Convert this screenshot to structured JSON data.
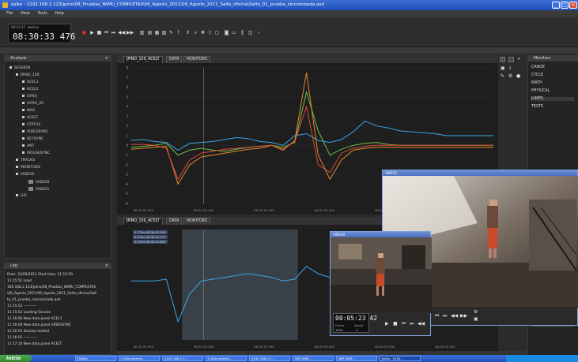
{
  "window": {
    "title": "qslko - \\\\192.168.2.123\\jpino\\08_Pruebas_WIMU_COMPLETAS\\06_Agosto_2011\\09_Agosto_2011_Salto_oficina\\Salto_01_prueba_sincronizada.qsd"
  },
  "menu": [
    "File",
    "View",
    "Tools",
    "Help"
  ],
  "clock": {
    "small_time": "00:03:37",
    "small_label": "session",
    "time": "08:30:33 476"
  },
  "analysis": {
    "title": "Analysis",
    "tree": [
      {
        "label": "SESSION",
        "indent": 0
      },
      {
        "label": "JPINO_150",
        "indent": 1
      },
      {
        "label": "ACEL1",
        "indent": 2
      },
      {
        "label": "ACEL2",
        "indent": 2
      },
      {
        "label": "GYRO",
        "indent": 2
      },
      {
        "label": "GYRO_45",
        "indent": 2
      },
      {
        "label": "MAG",
        "indent": 2
      },
      {
        "label": "ACELT",
        "indent": 2
      },
      {
        "label": "STATUS",
        "indent": 2
      },
      {
        "label": "VIDEOSYNC",
        "indent": 2
      },
      {
        "label": "KEYSYNC",
        "indent": 2
      },
      {
        "label": "ANT",
        "indent": 2
      },
      {
        "label": "MOUSESYNC",
        "indent": 2
      },
      {
        "label": "TRACKS",
        "indent": 1
      },
      {
        "label": "MONITORS",
        "indent": 1
      },
      {
        "label": "VIDEOS",
        "indent": 1
      },
      {
        "label": "VIDEO0",
        "indent": 3
      },
      {
        "label": "VIDEO1",
        "indent": 3
      },
      {
        "label": "GIS",
        "indent": 1
      }
    ]
  },
  "log": {
    "title": "Log",
    "lines": [
      "Date: 31/09/2011   Start time: 11:15:50",
      "11:15:52 Load",
      "192.168.2.123/jpino/08_Pruebas_WIMU_COMPLETAS",
      "\\06_Agosto_2011/09_Agosto_2011_Salto_oficina/Salt",
      "to_01_prueba_sincronizada.qsd",
      "11:15:52 -----------",
      "11:15:52 Loading Session",
      "11:16:00 New data panel ACEL1",
      "11:16:00 New data panel VIDEOSYNC",
      "11:16:01 Session loaded",
      "11:16:01 -----------",
      "11:17:10 New data panel ACELT"
    ]
  },
  "monitors": {
    "title": "Monitors",
    "items": [
      "CANOE",
      "CYCLE",
      "MATH",
      "PHYSICAL",
      "JUMPS",
      "TESTS"
    ]
  },
  "panel1": {
    "tabs": [
      "JPINO_150_ACELT",
      "DATA",
      "MONITORS"
    ]
  },
  "panel2": {
    "tabs": [
      "JPINO_150_ACELT",
      "DATA",
      "MONITORS"
    ]
  },
  "video_small": {
    "title": "VIDEO0",
    "time": "00:05:23 42",
    "frame_label": "Frame",
    "frame": "7674",
    "speed_label": "Speed",
    "speed": "1"
  },
  "video_large": {
    "title": "VIDEO1"
  },
  "taskbar": {
    "start": "Inicio",
    "tasks": [
      "Firefox",
      "C:\\Documents...",
      "\\\\192.168.2.1...",
      "C:\\Documents...",
      "\\\\192.168.2.1...",
      "WIP_WIM...",
      "WIP_WIM...",
      "qslko - \\\\192..."
    ]
  },
  "colors": {
    "series_blue": "#3aa6e6",
    "series_green": "#6cc04a",
    "series_orange": "#e08a2c",
    "series_red": "#d84a3a",
    "accent": "#3a6fd8"
  },
  "chart_data": [
    {
      "type": "line",
      "title": "",
      "x": [
        "08:30:31.990",
        "08:30:32.490",
        "08:30:32.990",
        "08:30:33.490",
        "08:30:33.990",
        "08:30:34.490"
      ],
      "yticks": [
        8,
        7,
        6,
        5,
        4,
        3,
        2,
        1,
        0,
        -1,
        -2,
        -3,
        -4,
        -5,
        -6
      ],
      "ylim": [
        -6,
        8
      ],
      "series": [
        {
          "values": [
            0.5,
            0.6,
            0.4,
            0.3,
            -0.5,
            0.2,
            0.3,
            0.4,
            0.6,
            0.8,
            0.7,
            0.4,
            0.3,
            0.0,
            1.0,
            1.2,
            0.5,
            0.3,
            0.6,
            1.4,
            2.5,
            2.0,
            1.8,
            1.5,
            1.4,
            1.3,
            1.2,
            1.0,
            1.0,
            1.0,
            1.0,
            1.0
          ]
        },
        {
          "values": [
            -0.2,
            -0.1,
            0.0,
            0.2,
            -1.0,
            -0.5,
            -0.3,
            -0.5,
            -0.6,
            -0.4,
            -0.2,
            -0.1,
            0.0,
            -0.2,
            0.3,
            5.5,
            1.5,
            -1.0,
            -0.4,
            0.0,
            0.2,
            0.3,
            0.1,
            0.0,
            0.0,
            0.0,
            0.0,
            0.0,
            0.0,
            0.0,
            0.0,
            0.0
          ]
        },
        {
          "values": [
            -0.4,
            -0.3,
            -0.2,
            -0.1,
            -4.0,
            -2.0,
            -1.2,
            -1.0,
            -0.8,
            -0.6,
            -0.4,
            -0.3,
            0.0,
            -0.5,
            0.5,
            7.5,
            -1.0,
            -3.5,
            -1.5,
            -0.5,
            -0.3,
            -0.2,
            -0.2,
            -0.2,
            -0.2,
            -0.2,
            -0.2,
            -0.2,
            -0.2,
            -0.2,
            -0.2,
            -0.2
          ]
        },
        {
          "values": [
            0.1,
            0.1,
            0.0,
            -0.3,
            -3.5,
            -1.5,
            -0.8,
            -0.6,
            -0.4,
            -0.3,
            -0.2,
            -0.1,
            0.0,
            -0.4,
            0.4,
            4.0,
            -2.0,
            -2.8,
            -0.8,
            -0.3,
            -0.1,
            0.0,
            0.0,
            0.0,
            0.0,
            0.0,
            0.0,
            0.0,
            0.0,
            0.0,
            0.0,
            0.0
          ]
        }
      ]
    },
    {
      "type": "line",
      "title": "",
      "x": [
        "08:30:31.990",
        "08:30:32.490",
        "08:30:32.990",
        "08:30:33.490",
        "08:30:33.990",
        "08:30:34.490"
      ],
      "legend": [
        "0.270m 08:30:31.550",
        "0.370m 08:30:31.770",
        "0.370m 08:30:31.800"
      ],
      "series": [
        {
          "values": [
            0.2,
            0.2,
            0.2,
            0.3,
            -2.0,
            -0.5,
            0.2,
            0.3,
            0.4,
            0.5,
            0.6,
            0.5,
            0.4,
            0.2,
            0.3,
            1.0,
            0.6,
            0.4,
            0.3,
            0.3,
            0.3,
            0.3,
            0.3,
            0.3,
            0.3,
            0.3,
            0.3,
            0.3,
            0.3,
            0.3,
            0.3,
            0.3
          ]
        }
      ]
    }
  ]
}
